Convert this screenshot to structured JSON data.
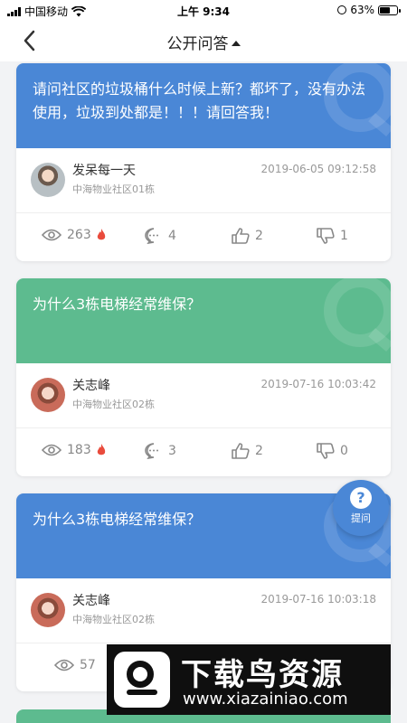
{
  "status_bar": {
    "carrier": "中国移动",
    "time": "上午 9:34",
    "battery_percent": "63%",
    "battery_level": 0.63
  },
  "nav": {
    "title": "公开问答"
  },
  "colors": {
    "blue": "#4a87d6",
    "green": "#5dbb8f",
    "hot": "#e94b3c",
    "muted": "#888888"
  },
  "questions": [
    {
      "title": "请问社区的垃圾桶什么时候上新？都坏了，没有办法使用，垃圾到处都是！！！请回答我！",
      "color": "blue",
      "user": "发呆每一天",
      "community": "中海物业社区01栋",
      "date": "2019-06-05 09:12:58",
      "views": "263",
      "comments": "4",
      "likes": "2",
      "dislikes": "1"
    },
    {
      "title": "为什么3栋电梯经常维保？",
      "color": "green",
      "user": "关志峰",
      "community": "中海物业社区02栋",
      "date": "2019-07-16 10:03:42",
      "views": "183",
      "comments": "3",
      "likes": "2",
      "dislikes": "0"
    },
    {
      "title": "为什么3栋电梯经常维保？",
      "color": "blue",
      "user": "关志峰",
      "community": "中海物业社区02栋",
      "date": "2019-07-16 10:03:18",
      "views": "57"
    }
  ],
  "ask_button": {
    "label": "提问"
  },
  "watermark": {
    "title": "下载鸟资源",
    "url": "www.xiazainiao.com"
  }
}
